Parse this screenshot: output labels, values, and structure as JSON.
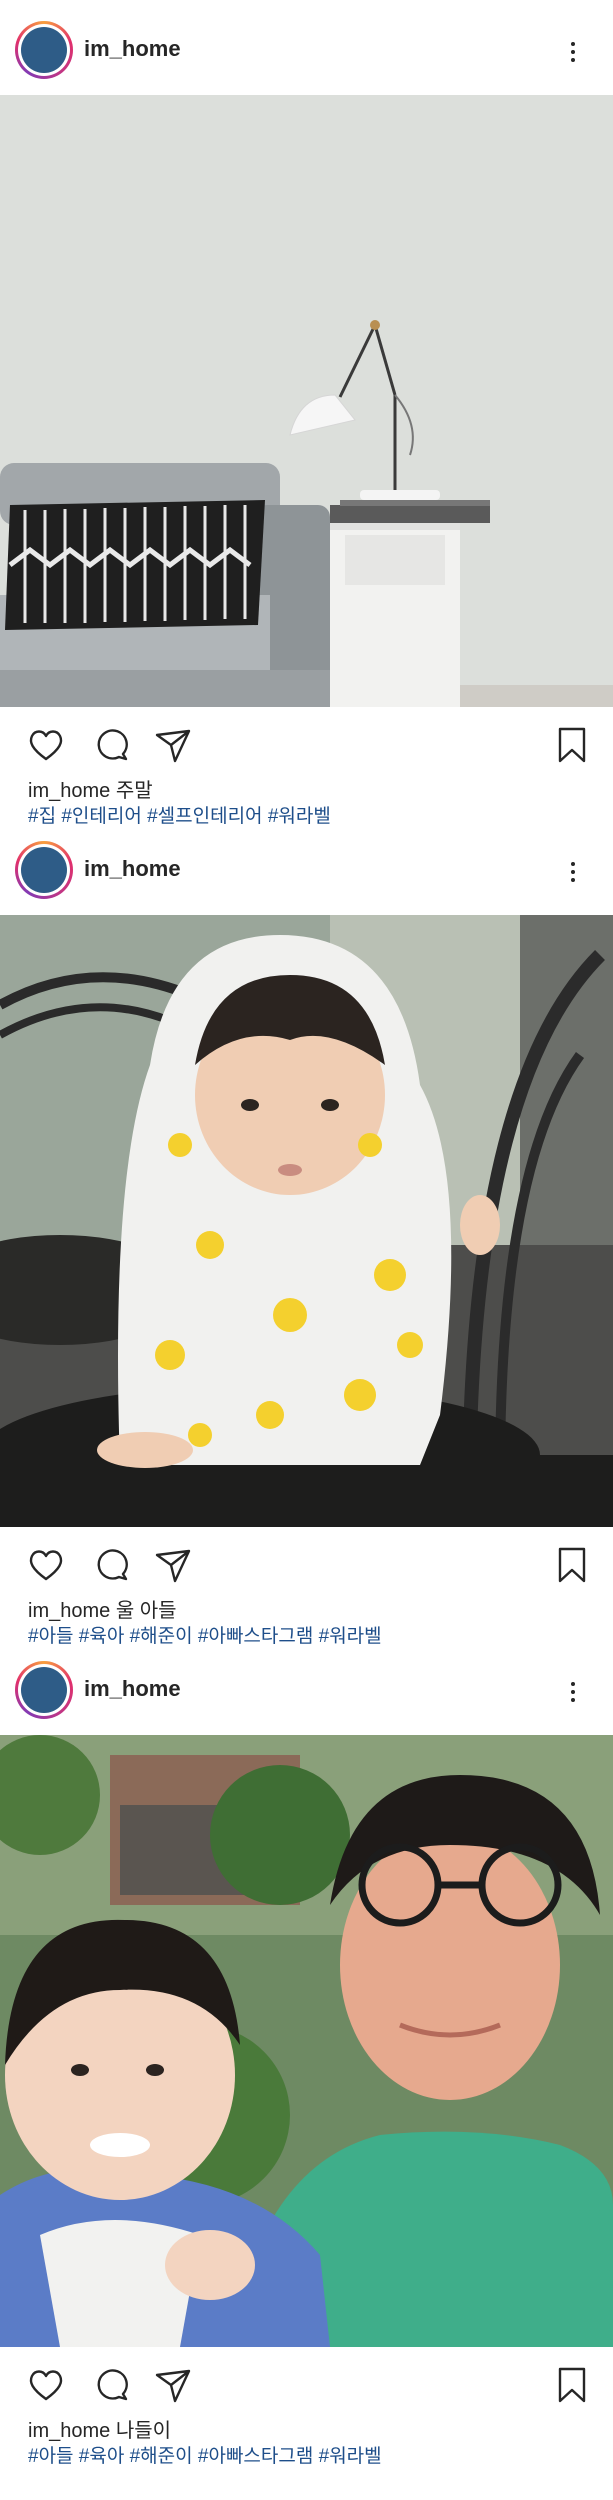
{
  "colors": {
    "avatar": "#2e5c87",
    "hashtag": "#1e4e8a",
    "text": "#262626"
  },
  "posts": [
    {
      "username": "im_home",
      "photo_description_icon": "living-room-photo",
      "caption_user": "im_home",
      "caption_text": "주말",
      "hashtags": "#집 #인테리어 #셀프인테리어 #워라벨"
    },
    {
      "username": "im_home",
      "photo_description_icon": "toddler-raincoat-photo",
      "caption_user": "im_home",
      "caption_text": "울 아들",
      "hashtags": "#아들 #육아 #해준이 #아빠스타그램 #워라벨"
    },
    {
      "username": "im_home",
      "photo_description_icon": "father-son-selfie-photo",
      "caption_user": "im_home",
      "caption_text": "나들이",
      "hashtags": "#아들 #육아 #해준이 #아빠스타그램 #워라벨"
    }
  ],
  "icons": {
    "like": "heart-icon",
    "comment": "comment-icon",
    "share": "paper-plane-icon",
    "save": "bookmark-icon",
    "more": "more-vertical-icon"
  }
}
